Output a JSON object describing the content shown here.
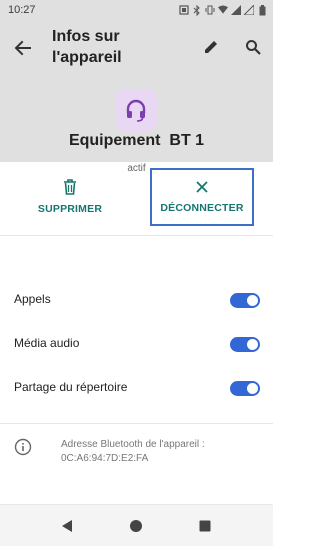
{
  "status_bar": {
    "time": "10:27",
    "icons": [
      "screenshot-icon",
      "bluetooth-icon",
      "vibrate-icon",
      "wifi-icon",
      "signal-icon",
      "signal-icon",
      "battery-icon"
    ]
  },
  "header": {
    "title": "Infos sur l'appareil",
    "back_icon": "arrow-back-icon",
    "edit_icon": "pencil-icon",
    "search_icon": "search-icon"
  },
  "device": {
    "icon": "headset-icon",
    "name": "Equipement  BT 1",
    "status": "actif"
  },
  "actions": {
    "delete_label": "SUPPRIMER",
    "disconnect_label": "DÉCONNECTER"
  },
  "settings": [
    {
      "label": "Appels",
      "enabled": true
    },
    {
      "label": "Média audio",
      "enabled": true
    },
    {
      "label": "Partage du répertoire",
      "enabled": true
    }
  ],
  "info": {
    "text": "Adresse Bluetooth de l'appareil : 0C:A6:94:7D:E2:FA"
  },
  "colors": {
    "header_bg": "#e0e0e0",
    "accent_teal": "#15766e",
    "toggle_blue": "#3467d6",
    "device_icon_bg": "#e8d8f3",
    "device_icon_fg": "#7b3fb0"
  }
}
